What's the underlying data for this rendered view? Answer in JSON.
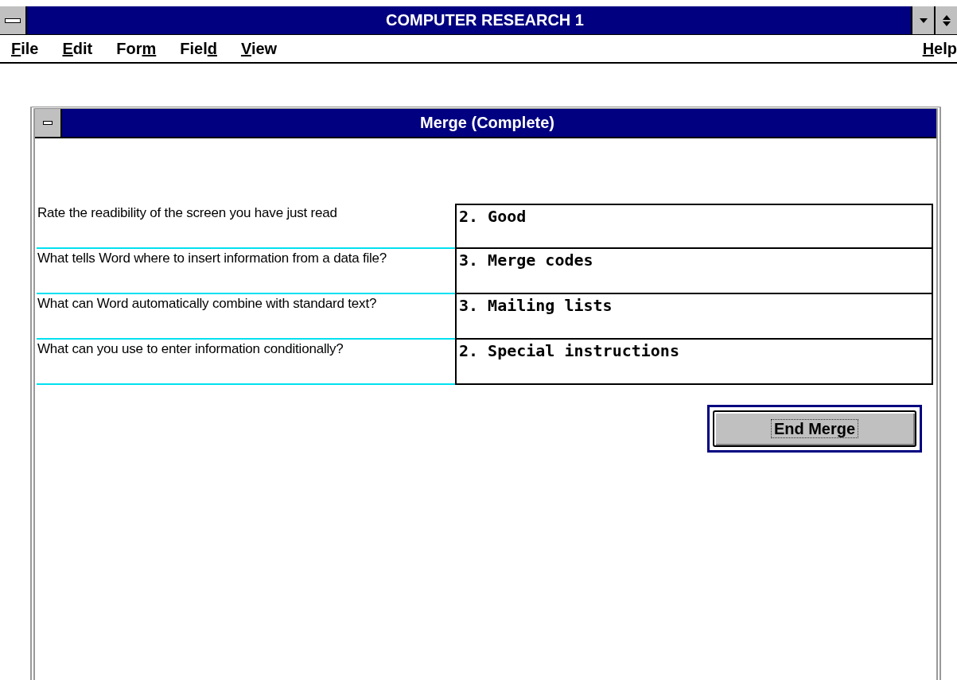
{
  "window": {
    "title": "COMPUTER RESEARCH 1"
  },
  "menu": [
    {
      "key": "F",
      "post": "ile"
    },
    {
      "key": "E",
      "post": "dit"
    },
    {
      "pre": "For",
      "key": "m"
    },
    {
      "pre": "Fiel",
      "key": "d"
    },
    {
      "key": "V",
      "post": "iew"
    }
  ],
  "help_menu": {
    "key": "H",
    "post": "elp"
  },
  "dialog": {
    "title": "Merge (Complete)",
    "rows": [
      {
        "question": "Rate the readibility of the screen you have just read",
        "answer": "2. Good"
      },
      {
        "question": "What tells Word where to insert information from a data file?",
        "answer": "3. Merge codes"
      },
      {
        "question": "What can Word automatically combine with standard text?",
        "answer": "3. Mailing lists"
      },
      {
        "question": "What can you use to enter information conditionally?",
        "answer": "2. Special instructions"
      }
    ],
    "button": "End Merge"
  }
}
